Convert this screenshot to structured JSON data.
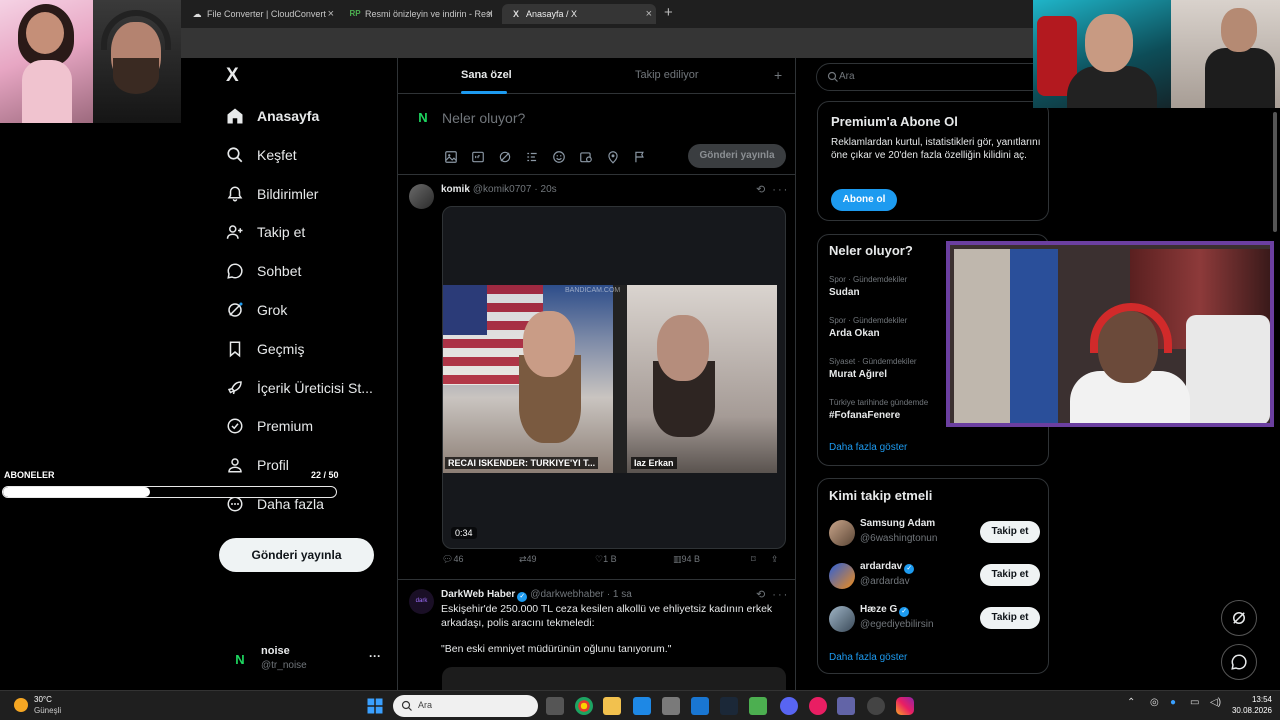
{
  "browser": {
    "tabs": [
      {
        "label": "File Converter | CloudConvert",
        "favicon": "cloud-icon"
      },
      {
        "label": "Resmi önizleyin ve indirin - Resi",
        "favicon": "rp-icon",
        "favicon_text": "RP"
      },
      {
        "label": "Anasayfa / X",
        "favicon": "x-logo-icon",
        "favicon_text": "X",
        "active": true
      }
    ],
    "new_tab": "+"
  },
  "overlay": {
    "subscribers_label": "ABONELER",
    "subscribers_count": "22 / 50",
    "subscribers_progress": 0.44
  },
  "nav": {
    "logo": "X",
    "items": [
      {
        "label": "Anasayfa",
        "icon": "home-icon"
      },
      {
        "label": "Keşfet",
        "icon": "search-icon"
      },
      {
        "label": "Bildirimler",
        "icon": "bell-icon"
      },
      {
        "label": "Takip et",
        "icon": "add-user-icon"
      },
      {
        "label": "Sohbet",
        "icon": "chat-icon"
      },
      {
        "label": "Grok",
        "icon": "grok-icon"
      },
      {
        "label": "Geçmiş",
        "icon": "bookmark-icon"
      },
      {
        "label": "İçerik Üreticisi St...",
        "icon": "rocket-icon"
      },
      {
        "label": "Premium",
        "icon": "premium-icon"
      },
      {
        "label": "Profil",
        "icon": "profile-icon"
      },
      {
        "label": "Daha fazla",
        "icon": "more-circle-icon"
      }
    ],
    "post_button": "Gönderi yayınla",
    "account": {
      "name": "noise",
      "handle": "@tr_noise",
      "more": "···",
      "avatar_text": "N"
    }
  },
  "feed": {
    "tabs": [
      "Sana özel",
      "Takip ediliyor"
    ],
    "tab_add": "+",
    "composer": {
      "placeholder": "Neler oluyor?",
      "post_button": "Gönderi yayınla",
      "avatar_text": "N"
    },
    "posts": [
      {
        "name": "komik",
        "handle": "@komik0707",
        "time": "· 20s",
        "video": {
          "caption_left": "RECAI ISKENDER: TURKIYE'YI T...",
          "caption_right": "Iaz Erkan",
          "watermark": "BANDICAM.COM",
          "duration": "0:34"
        },
        "stats": {
          "replies": "46",
          "reposts": "49",
          "likes": "1 B",
          "views": "94 B"
        }
      },
      {
        "name": "DarkWeb Haber",
        "handle": "@darkwebhaber",
        "time": "· 1 sa",
        "text": "Eskişehir'de 250.000 TL ceza kesilen alkollü ve ehliyetsiz kadının erkek arkadaşı, polis aracını tekmeledi:",
        "quote": "\"Ben eski emniyet müdürünün oğlunu tanıyorum.\""
      }
    ]
  },
  "sidebar": {
    "search_placeholder": "Ara",
    "premium": {
      "title": "Premium'a Abone Ol",
      "text": "Reklamlardan kurtul, istatistikleri gör, yanıtlarını öne çıkar ve 20'den fazla özelliğin kilidini aç.",
      "button": "Abone ol"
    },
    "trends": {
      "title": "Neler oluyor?",
      "items": [
        {
          "category": "Spor · Gündemdekiler",
          "title": "Sudan"
        },
        {
          "category": "Spor · Gündemdekiler",
          "title": "Arda Okan"
        },
        {
          "category": "Siyaset · Gündemdekiler",
          "title": "Murat Ağırel"
        },
        {
          "category": "Türkiye tarihinde gündemde",
          "title": "#FofanaFenere"
        }
      ],
      "more": "Daha fazla göster"
    },
    "who_to_follow": {
      "title": "Kimi takip etmeli",
      "users": [
        {
          "name": "Samsung Adam",
          "handle": "@6washingtonun",
          "verified": false,
          "button": "Takip et"
        },
        {
          "name": "ardardav",
          "handle": "@ardardav",
          "verified": true,
          "button": "Takip et"
        },
        {
          "name": "Hæze G",
          "handle": "@egediyebilirsin",
          "verified": true,
          "button": "Takip et"
        }
      ],
      "more": "Daha fazla göster"
    }
  },
  "taskbar": {
    "weather_temp": "30°C",
    "weather_cond": "Güneşli",
    "search_placeholder": "Ara",
    "time": "13:54",
    "date": "30.08.2026"
  },
  "colors": {
    "accent": "#1d9bf0",
    "border": "#2f3336",
    "muted": "#71767b",
    "stream_frame": "#6b3fa0"
  }
}
